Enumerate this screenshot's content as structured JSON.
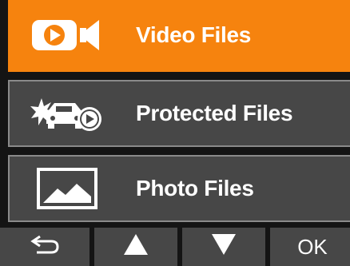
{
  "menu": {
    "items": [
      {
        "label": "Video Files",
        "icon": "video-camera-icon",
        "selected": true
      },
      {
        "label": "Protected Files",
        "icon": "protected-car-icon",
        "selected": false
      },
      {
        "label": "Photo Files",
        "icon": "photo-landscape-icon",
        "selected": false
      }
    ]
  },
  "buttons": {
    "back_icon": "return-arrow-icon",
    "up_icon": "triangle-up-icon",
    "down_icon": "triangle-down-icon",
    "ok_label": "OK"
  },
  "colors": {
    "selected": "#f6830e",
    "item": "#474747",
    "border": "#8a8a8a",
    "text": "#ffffff"
  }
}
